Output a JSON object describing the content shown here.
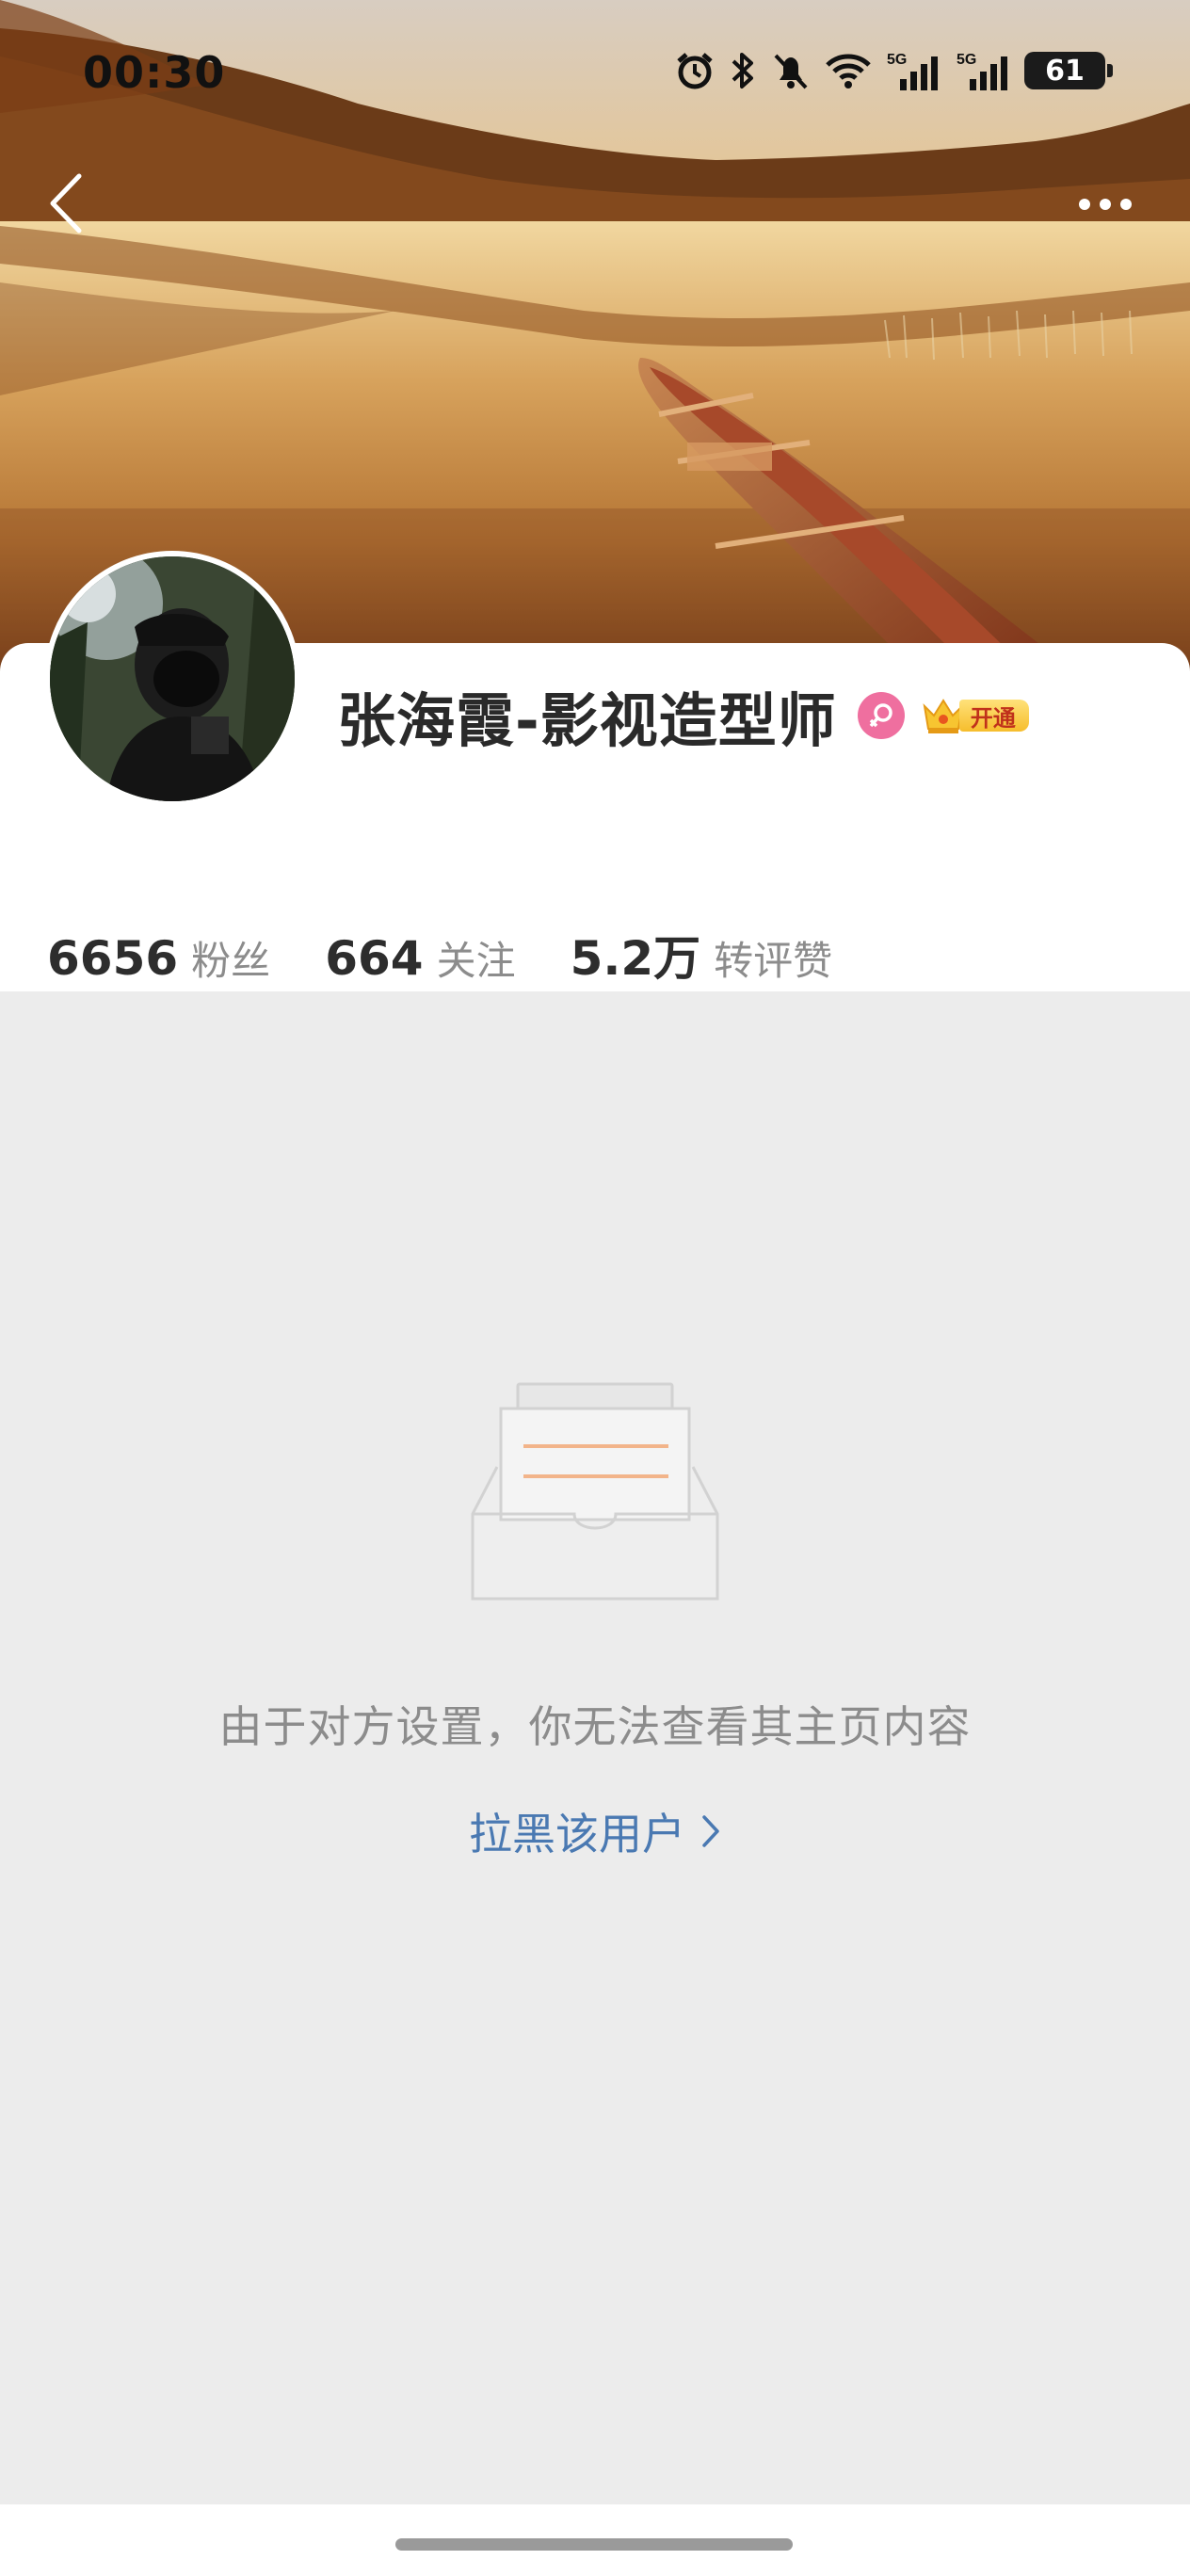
{
  "status_bar": {
    "time": "00:30",
    "icons": [
      "alarm-icon",
      "bluetooth-icon",
      "mute-icon",
      "wifi-icon",
      "signal-5g-icon",
      "signal-5g-icon"
    ],
    "signal_label_1": "5G",
    "signal_label_2": "5G",
    "battery": "61"
  },
  "nav": {
    "back_icon": "chevron-left-icon",
    "more_icon": "more-dots-icon"
  },
  "profile": {
    "name": "张海霞-影视造型师",
    "gender_icon": "female-icon",
    "vip_icon": "crown-icon",
    "vip_label": "开通",
    "stats": [
      {
        "value": "6656",
        "label": "粉丝"
      },
      {
        "value": "664",
        "label": "关注"
      },
      {
        "value": "5.2万",
        "label": "转评赞"
      }
    ]
  },
  "empty_state": {
    "icon": "empty-inbox-icon",
    "message": "由于对方设置，你无法查看其主页内容",
    "action_label": "拉黑该用户",
    "action_icon": "chevron-right-icon"
  },
  "colors": {
    "link": "#4a79b2",
    "gender_badge": "#ef6f9f",
    "vip_gold": "#f6bd2c",
    "empty_bg": "#ececec"
  }
}
